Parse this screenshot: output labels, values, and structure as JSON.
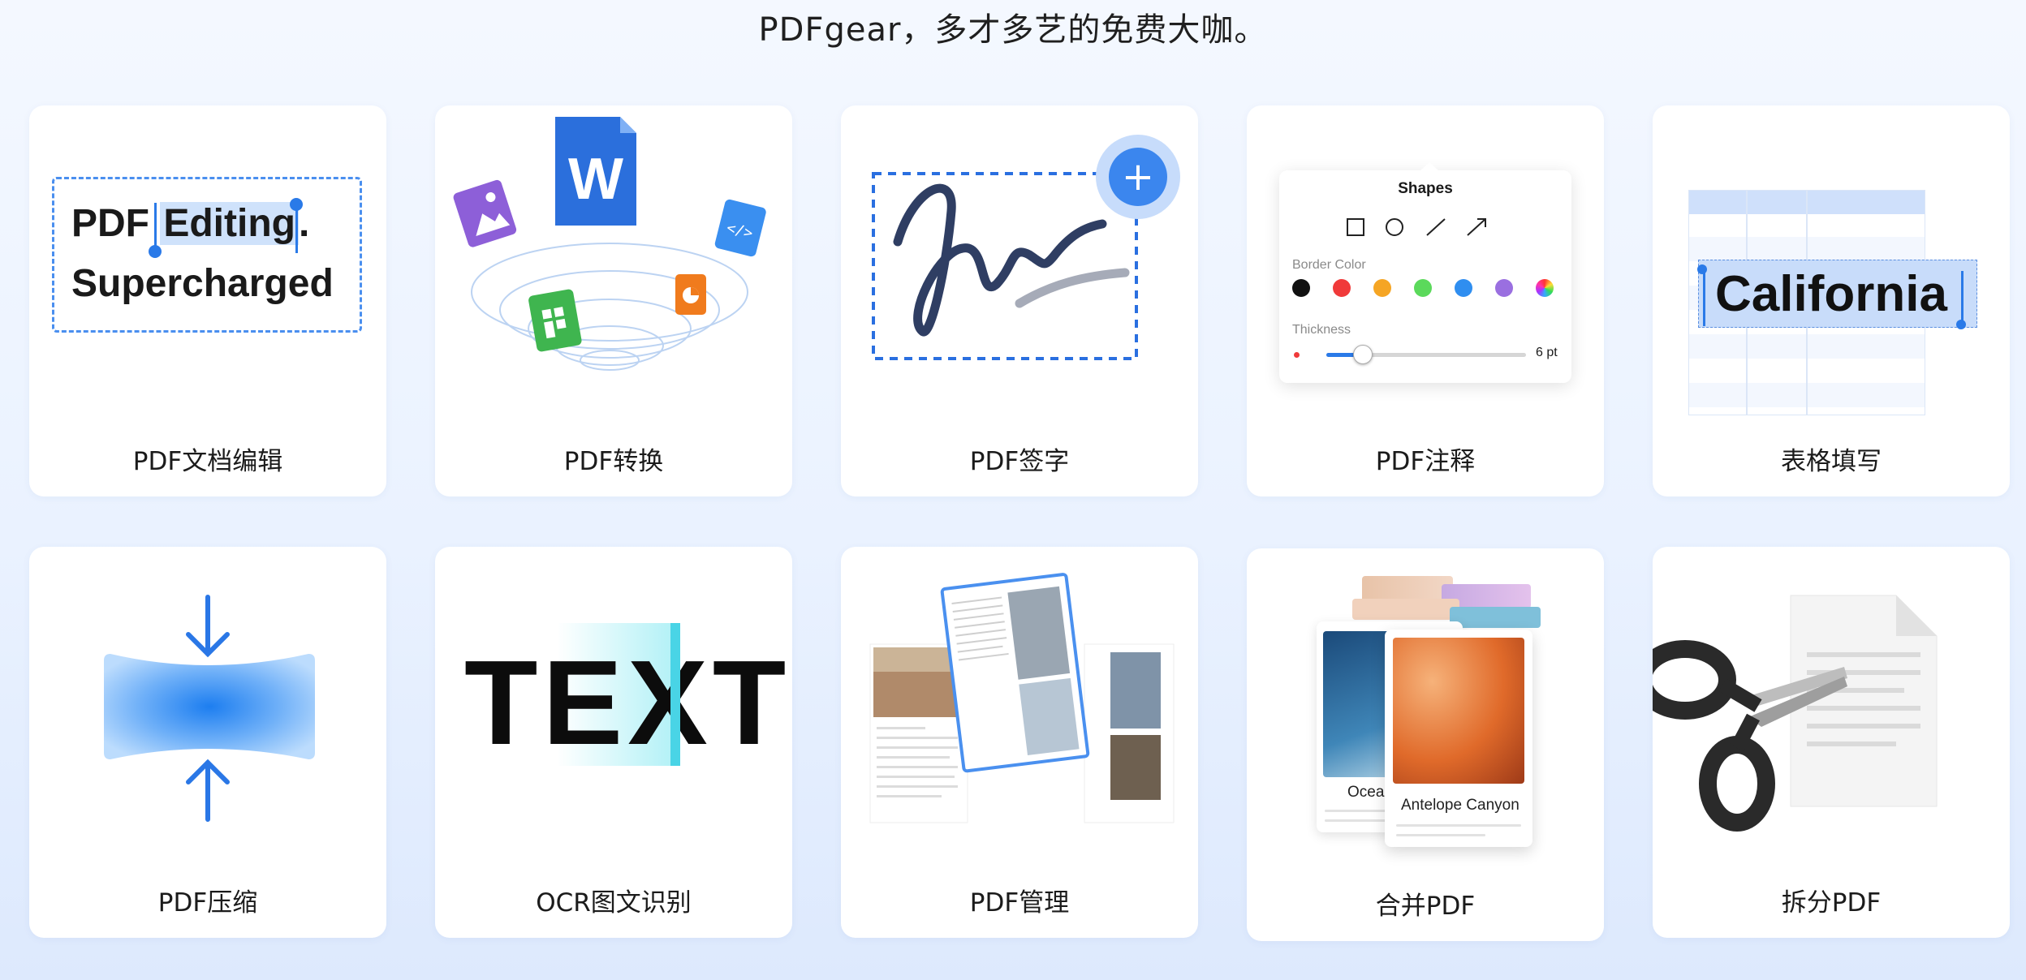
{
  "headline": "PDFgear，多才多艺的免费大咖。",
  "cards": [
    {
      "label": "PDF文档编辑",
      "illus": {
        "line1_a": "PDF ",
        "line1_b": "Editing",
        "line1_c": ".",
        "line2": "Supercharged"
      }
    },
    {
      "label": "PDF转换",
      "illus": {
        "word_letter": "W",
        "code_glyph": "</>"
      }
    },
    {
      "label": "PDF签字",
      "illus": {
        "plus": "+"
      }
    },
    {
      "label": "PDF注释",
      "illus": {
        "title": "Shapes",
        "border_color": "Border Color",
        "thickness": "Thickness",
        "thickness_value": "6 pt",
        "thickness_level": 0.18,
        "colors": [
          "#111111",
          "#f03a3a",
          "#f5a524",
          "#5bd95b",
          "#2f8ef0",
          "#9a6fe0"
        ]
      }
    },
    {
      "label": "表格填写",
      "illus": {
        "value": "California"
      }
    },
    {
      "label": "PDF压缩",
      "illus": {}
    },
    {
      "label": "OCR图文识别",
      "illus": {
        "text": "TEXT"
      }
    },
    {
      "label": "PDF管理",
      "illus": {}
    },
    {
      "label": "合并PDF",
      "illus": {
        "caption_back": "Ocea",
        "caption_front": "Antelope Canyon"
      }
    },
    {
      "label": "拆分PDF",
      "illus": {}
    }
  ]
}
